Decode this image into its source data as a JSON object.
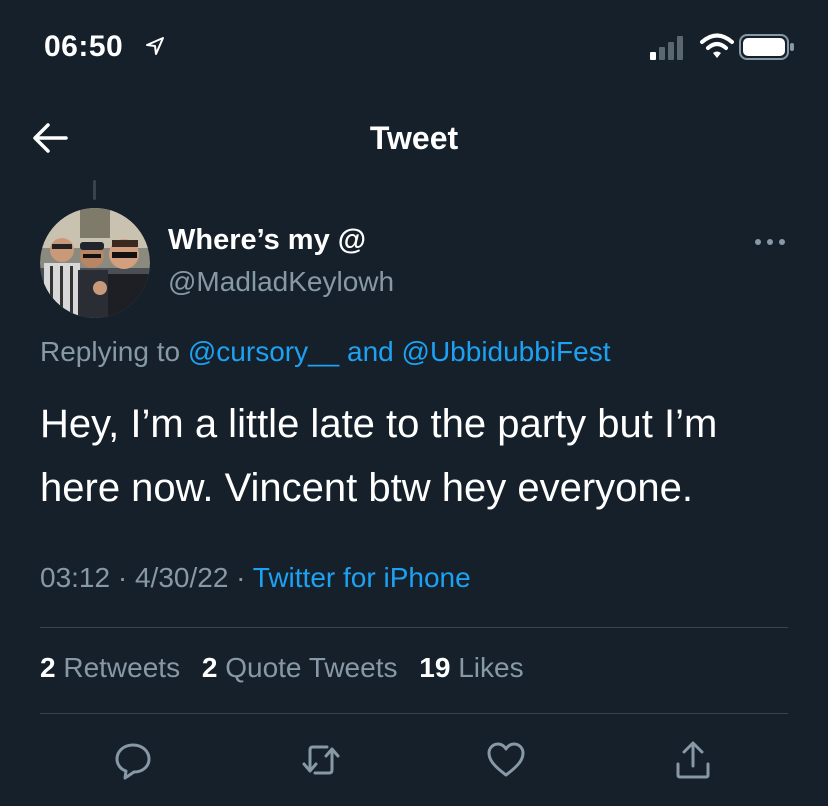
{
  "status_bar": {
    "time": "06:50"
  },
  "nav": {
    "title": "Tweet"
  },
  "author": {
    "name": "Where’s my @",
    "handle": "@MadladKeylowh"
  },
  "reply": {
    "prefix": "Replying to",
    "mention1": "@cursory__",
    "conjunction": "and",
    "mention2": "@UbbidubbiFest"
  },
  "tweet": {
    "text": "Hey, I’m a little late to the party but I’m here now. Vincent btw hey everyone."
  },
  "meta": {
    "time": "03:12",
    "separator": "·",
    "date": "4/30/22",
    "source": "Twitter for iPhone"
  },
  "stats": {
    "retweets_count": "2",
    "retweets_label": "Retweets",
    "quotes_count": "2",
    "quotes_label": "Quote Tweets",
    "likes_count": "19",
    "likes_label": "Likes"
  },
  "colors": {
    "background": "#15202b",
    "accent": "#1da1f2",
    "secondary_text": "#8899a6",
    "divider": "#38444d"
  },
  "icons": {
    "back": "arrow-left-icon",
    "more": "more-horizontal-icon",
    "reply": "reply-icon",
    "retweet": "retweet-icon",
    "like": "heart-icon",
    "share": "share-icon"
  }
}
